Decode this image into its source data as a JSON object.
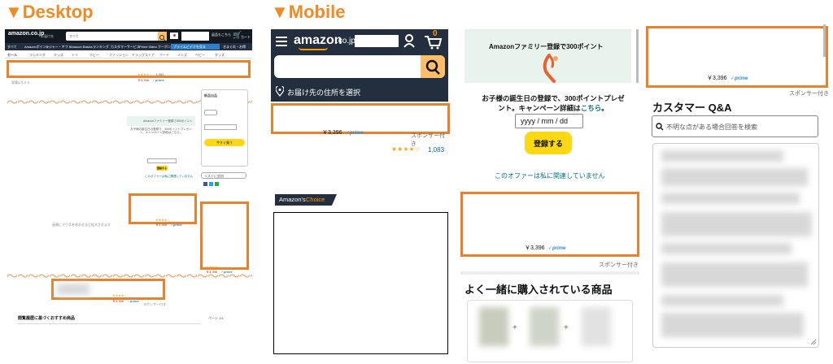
{
  "headers": {
    "desktop": "▼Desktop",
    "mobile": "▼Mobile"
  },
  "desktop": {
    "logo": "amazon.co.jp",
    "deliver": "お届け先",
    "search_placeholder": "すべて",
    "cart": "カート",
    "nav_items": [
      "すべて",
      "Amazonポイント",
      "レジャー・ギフト",
      "Amazon Basics",
      "ランキング",
      "カスタマーサービス",
      "Prime Video",
      "クーポン",
      "プライムビデオを見る",
      "きまぐれ・お得"
    ],
    "sub_nav": [
      "セール",
      "ランキング",
      "キッズ",
      "トイ",
      "ホビー",
      "ファッション",
      "ドラッグストア",
      "フード",
      "メンズ",
      "ベビー",
      "グッズ"
    ],
    "banner_price": "￥3,396",
    "banner_prime": "✓prime",
    "banner_rating": "1,083",
    "family_banner": "Amazonファミリー登録で300ポイント",
    "family_desc": "お子様の誕生日の登録で、300ポイントプレゼント。キャンペーン詳細はこちら。",
    "register": "登録する",
    "not_related": "このオファーは私に関連していません",
    "ad_price": "￥3,396",
    "ad_prime": "✓prime",
    "side_price": "￥3,396",
    "side_prime": "✓prime",
    "buy_now": "今すぐ買う",
    "cart_btn": "カートに入れる",
    "list_add": "リストに追加",
    "bottom_price": "￥3,396",
    "bottom_prime": "✓prime",
    "recs_title": "閲覧履歴に基づくおすすめ商品",
    "recs_page": "ページ 1/4",
    "sponsored": "スポンサー付き"
  },
  "mobile": {
    "logo": "amazon",
    "logo_suffix": ".co.jp",
    "cart_count": "0",
    "deliver": "お届け先の住所を選択",
    "ad_price": "￥3,396",
    "ad_prime": "✓prime",
    "sponsored": "スポンサー付き",
    "rating_count": "1,083",
    "choice_label": "Amazon's",
    "choice_label2": "Choice"
  },
  "family": {
    "title": "Amazonファミリー登録で300ポイント",
    "desc_line1": "お子様の誕生日の登録で、300ポイントプレゼ",
    "desc_line2": "ント。キャンペーン詳細は",
    "desc_link": "こちら",
    "desc_end": "。",
    "date_placeholder": "yyyy / mm / dd",
    "register": "登録する",
    "not_related": "このオファーは私に関連していません",
    "ad_price": "￥3,396",
    "ad_prime": "✓prime",
    "sponsored": "スポンサー付き",
    "fbt_title": "よく一緒に購入されている商品",
    "plus": "+"
  },
  "qa": {
    "ad_price": "￥3,396",
    "ad_prime": "✓prime",
    "sponsored": "スポンサー付き",
    "title": "カスタマー Q&A",
    "search_placeholder": "不明な点がある場合回答を検索"
  }
}
